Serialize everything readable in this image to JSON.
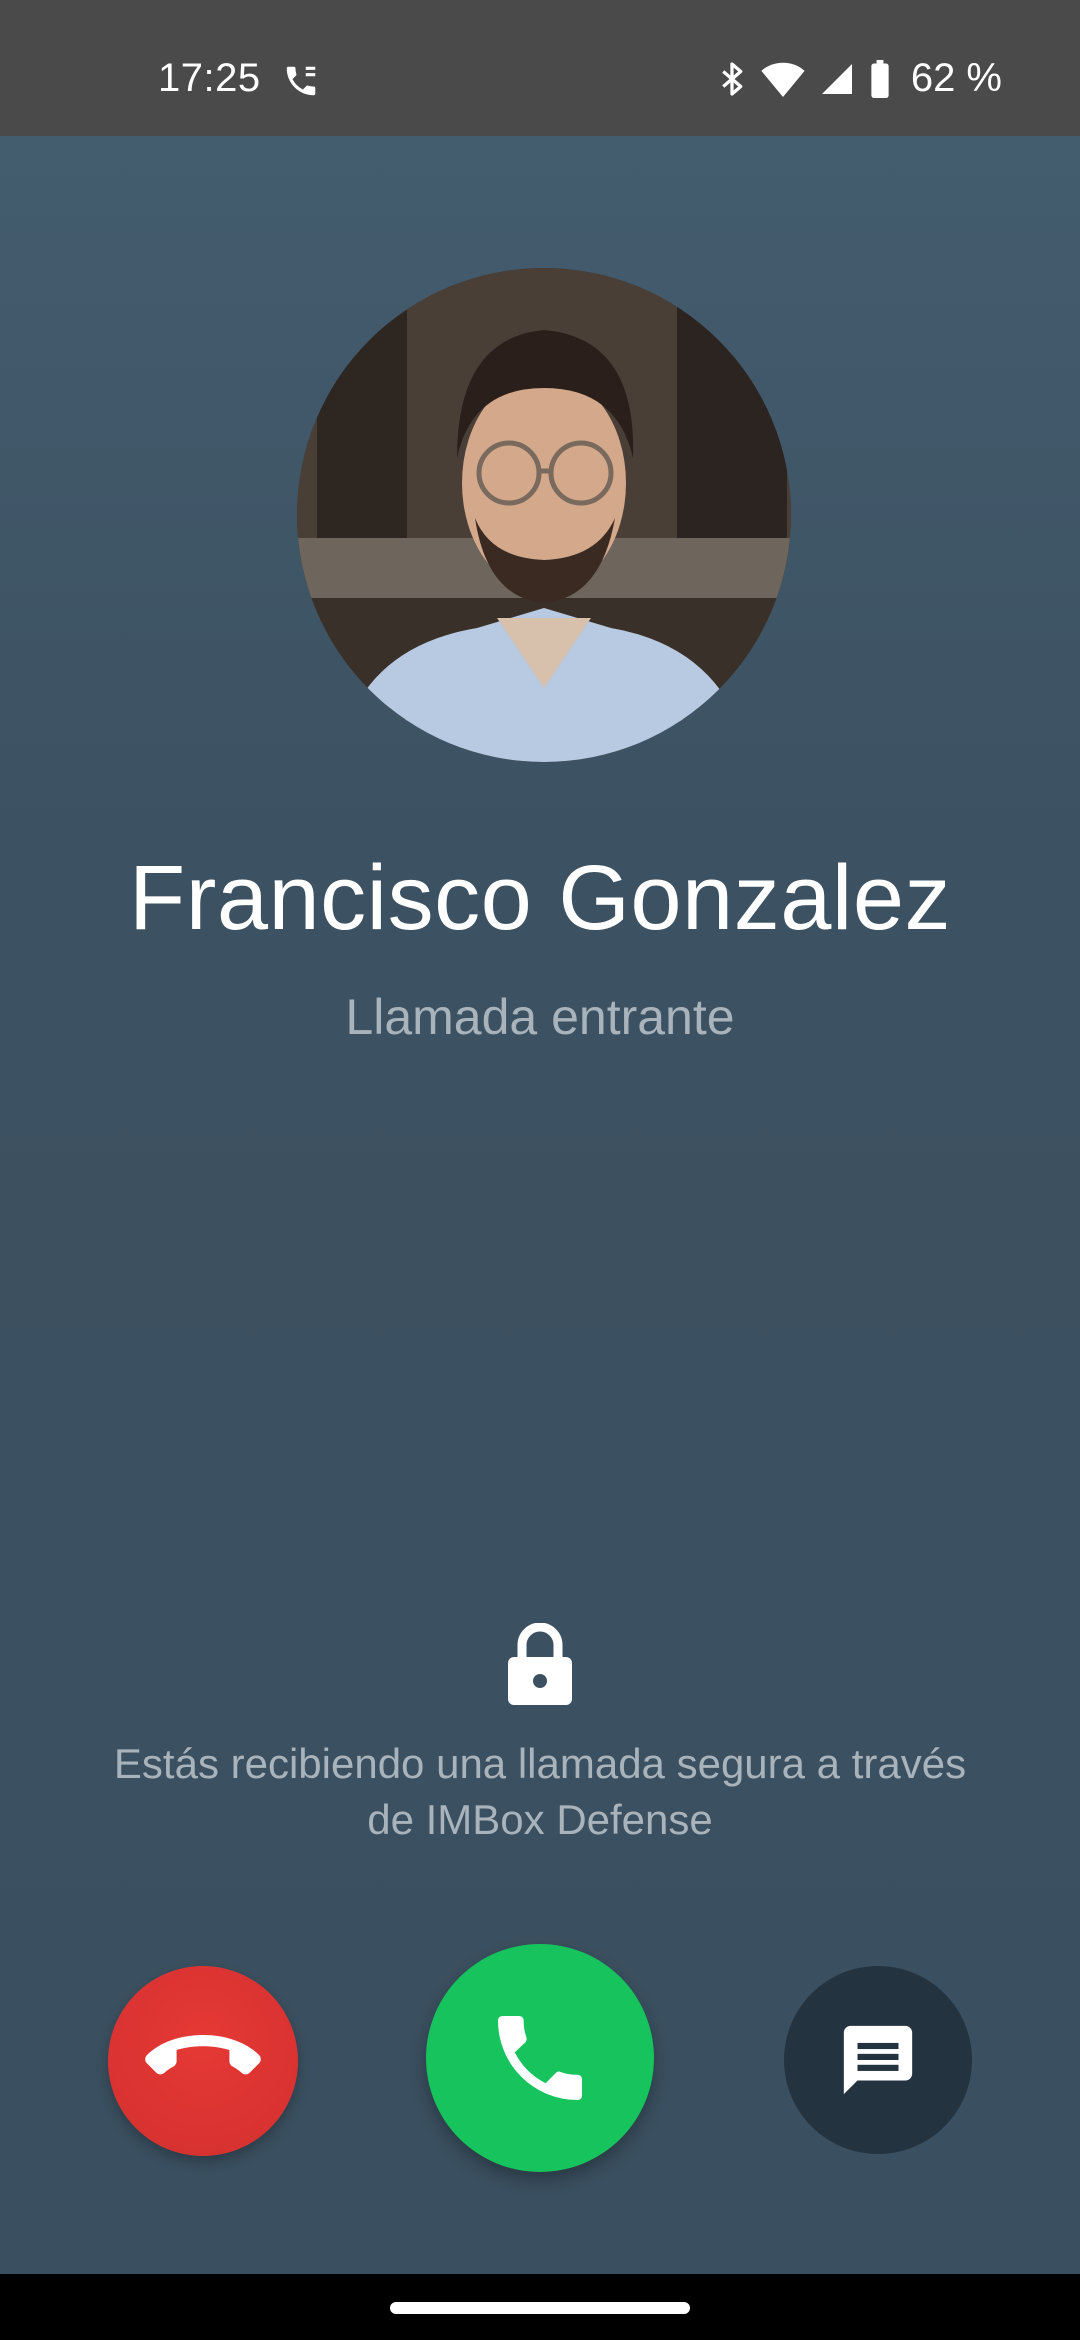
{
  "status_bar": {
    "time": "17:25",
    "battery_percent": "62 %",
    "icons": [
      "phone-call-icon",
      "bluetooth-icon",
      "wifi-icon",
      "signal-icon",
      "battery-icon"
    ]
  },
  "caller": {
    "name": "Francisco Gonzalez",
    "status": "Llamada entrante"
  },
  "security": {
    "icon": "lock-icon",
    "message": "Estás recibiendo una llamada segura a través de IMBox Defense"
  },
  "actions": {
    "decline": {
      "icon": "hang-up-icon",
      "color": "#e53935"
    },
    "answer": {
      "icon": "phone-icon",
      "color": "#16c35c"
    },
    "message": {
      "icon": "message-icon",
      "color": "#243340"
    }
  },
  "colors": {
    "background": "#3c5262",
    "status_bar": "#4a4a4a"
  }
}
